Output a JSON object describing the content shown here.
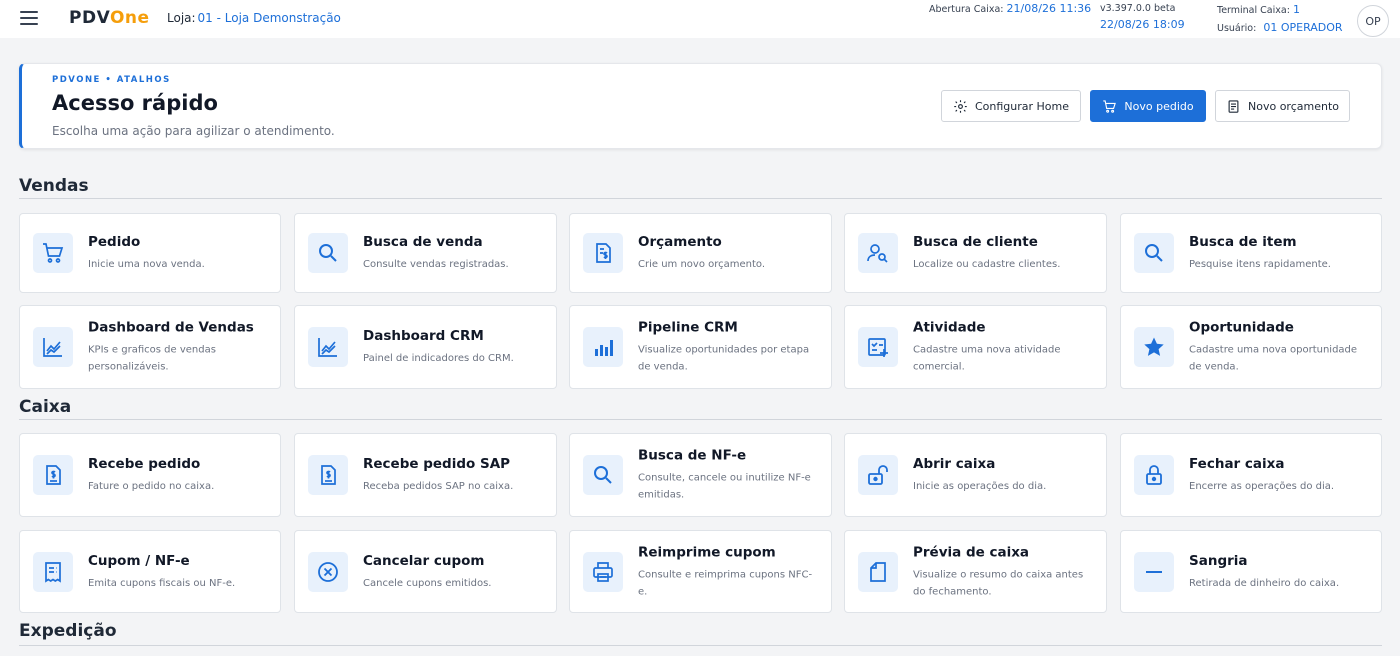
{
  "topbar": {
    "logo_a": "PDV",
    "logo_b": "One",
    "store_label": "Loja:",
    "store_value": "01 - Loja Demonstração",
    "abertura_label": "Abertura Caixa:",
    "abertura_value": "21/08/26 11:36",
    "version": "v3.397.0.0 beta",
    "datetime": "22/08/26 18:09",
    "terminal_label": "Terminal Caixa:",
    "terminal_value": "1",
    "user_label": "Usuário:",
    "user_value": "01 OPERADOR",
    "avatar": "OP"
  },
  "hero": {
    "kicker": "PDVONE • ATALHOS",
    "title": "Acesso rápido",
    "subtitle": "Escolha uma ação para agilizar o atendimento.",
    "btn_config": "Configurar Home",
    "btn_pedido": "Novo pedido",
    "btn_orcamento": "Novo orçamento"
  },
  "sections": {
    "vendas": "Vendas",
    "caixa": "Caixa",
    "expedicao": "Expedição"
  },
  "cards": {
    "pedido": {
      "title": "Pedido",
      "desc": "Inicie uma nova venda.",
      "icon": "cart-icon"
    },
    "busca_venda": {
      "title": "Busca de venda",
      "desc": "Consulte vendas registradas.",
      "icon": "search-icon"
    },
    "orcamento": {
      "title": "Orçamento",
      "desc": "Crie um novo orçamento.",
      "icon": "quote-document-icon"
    },
    "busca_cliente": {
      "title": "Busca de cliente",
      "desc": "Localize ou cadastre clientes.",
      "icon": "user-search-icon"
    },
    "busca_item": {
      "title": "Busca de item",
      "desc": "Pesquise itens rapidamente.",
      "icon": "search-icon"
    },
    "dash_vendas": {
      "title": "Dashboard de Vendas",
      "desc": "KPIs e graficos de vendas personalizáveis.",
      "icon": "line-chart-icon"
    },
    "dash_crm": {
      "title": "Dashboard CRM",
      "desc": "Painel de indicadores do CRM.",
      "icon": "line-chart-icon"
    },
    "pipeline": {
      "title": "Pipeline CRM",
      "desc": "Visualize oportunidades por etapa de venda.",
      "icon": "bar-chart-icon"
    },
    "atividade": {
      "title": "Atividade",
      "desc": "Cadastre uma nova atividade comercial.",
      "icon": "checklist-add-icon"
    },
    "oportunidade": {
      "title": "Oportunidade",
      "desc": "Cadastre uma nova oportunidade de venda.",
      "icon": "star-icon"
    },
    "recebe_pedido": {
      "title": "Recebe pedido",
      "desc": "Fature o pedido no caixa.",
      "icon": "invoice-icon"
    },
    "recebe_sap": {
      "title": "Recebe pedido SAP",
      "desc": "Receba pedidos SAP no caixa.",
      "icon": "invoice-icon"
    },
    "busca_nfe": {
      "title": "Busca de NF-e",
      "desc": "Consulte, cancele ou inutilize NF-e emitidas.",
      "icon": "search-icon"
    },
    "abrir_caixa": {
      "title": "Abrir caixa",
      "desc": "Inicie as operações do dia.",
      "icon": "unlock-icon"
    },
    "fechar_caixa": {
      "title": "Fechar caixa",
      "desc": "Encerre as operações do dia.",
      "icon": "lock-icon"
    },
    "cupom": {
      "title": "Cupom / NF-e",
      "desc": "Emita cupons fiscais ou NF-e.",
      "icon": "receipt-icon"
    },
    "cancelar_cupom": {
      "title": "Cancelar cupom",
      "desc": "Cancele cupons emitidos.",
      "icon": "cancel-circle-icon"
    },
    "reimprime": {
      "title": "Reimprime cupom",
      "desc": "Consulte e reimprima cupons NFC-e.",
      "icon": "printer-icon"
    },
    "previa": {
      "title": "Prévia de caixa",
      "desc": "Visualize o resumo do caixa antes do fechamento.",
      "icon": "document-icon"
    },
    "sangria": {
      "title": "Sangria",
      "desc": "Retirada de dinheiro do caixa.",
      "icon": "minus-icon"
    }
  },
  "colors": {
    "accent": "#1d6fd8",
    "brand_orange": "#f59e0b",
    "icon_bg": "#e8f1fc"
  }
}
